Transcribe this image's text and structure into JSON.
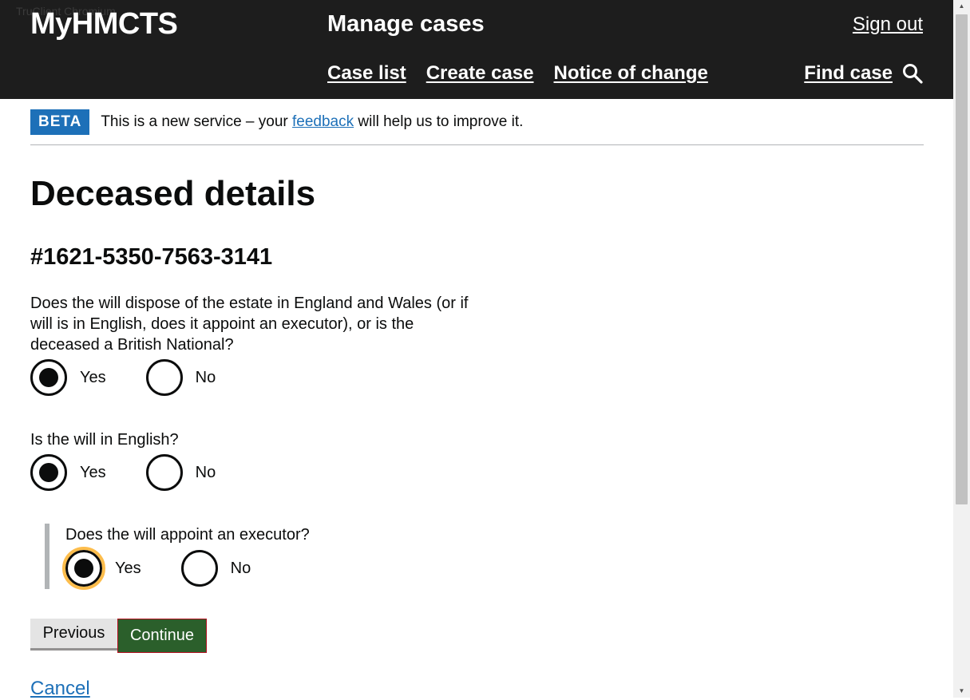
{
  "browser_label": "TruClient Chromium",
  "header": {
    "logo": "MyHMCTS",
    "service_name": "Manage cases",
    "sign_out": "Sign out",
    "nav": [
      "Case list",
      "Create case",
      "Notice of change"
    ],
    "find_case": "Find case"
  },
  "banner": {
    "tag": "BETA",
    "text_before": "This is a new service – your ",
    "link": "feedback",
    "text_after": " will help us to improve it."
  },
  "page": {
    "title": "Deceased details",
    "case_ref": "#1621-5350-7563-3141"
  },
  "questions": [
    {
      "text": "Does the will dispose of the estate in England and Wales (or if will is in English, does it appoint an executor), or is the deceased a British National?",
      "options": [
        "Yes",
        "No"
      ],
      "selected": "Yes"
    },
    {
      "text": "Is the will in English?",
      "options": [
        "Yes",
        "No"
      ],
      "selected": "Yes"
    },
    {
      "text": "Does the will appoint an executor?",
      "options": [
        "Yes",
        "No"
      ],
      "selected": "Yes"
    }
  ],
  "buttons": {
    "previous": "Previous",
    "continue": "Continue",
    "cancel": "Cancel"
  },
  "colors": {
    "header_bg": "#1d1d1d",
    "beta_tag": "#1d70b8",
    "link": "#1d70b8",
    "continue_bg": "#2b5f2b",
    "focus_ring": "#fdbd4c"
  },
  "icons": [
    "search-icon",
    "scroll-up-arrow-icon",
    "scroll-down-arrow-icon"
  ]
}
